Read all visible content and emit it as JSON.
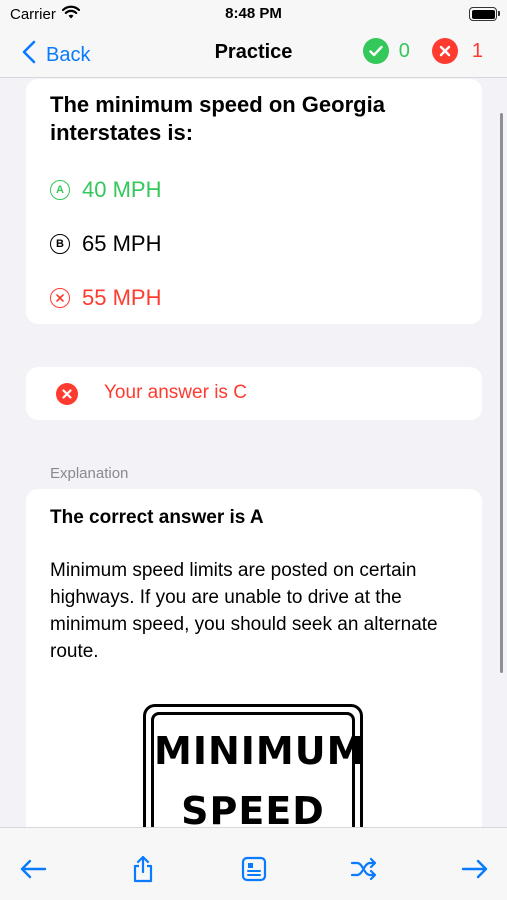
{
  "status_bar": {
    "carrier": "Carrier",
    "time": "8:48 PM"
  },
  "nav": {
    "back_label": "Back",
    "title": "Practice",
    "correct_count": "0",
    "incorrect_count": "1"
  },
  "question": {
    "text": "The minimum speed on Georgia interstates is:",
    "options": [
      {
        "marker": "A",
        "text": "40 MPH",
        "state": "correct"
      },
      {
        "marker": "B",
        "text": "65 MPH",
        "state": "neutral"
      },
      {
        "marker": "C",
        "text": "55 MPH",
        "state": "wrong"
      }
    ]
  },
  "result": {
    "text": "Your answer is C"
  },
  "explanation": {
    "section_label": "Explanation",
    "title": "The correct answer is A",
    "body": "Minimum speed limits are posted on certain highways. If you are unable to drive at the minimum speed, you should seek an alternate route.",
    "sign_line1": "MINIMUM",
    "sign_line2": "SPEED"
  },
  "colors": {
    "accent": "#0a7aff",
    "correct": "#34c759",
    "incorrect": "#ff3b30"
  },
  "toolbar": {
    "icons": [
      "arrow-left-icon",
      "share-icon",
      "note-icon",
      "shuffle-icon",
      "arrow-right-icon"
    ]
  }
}
